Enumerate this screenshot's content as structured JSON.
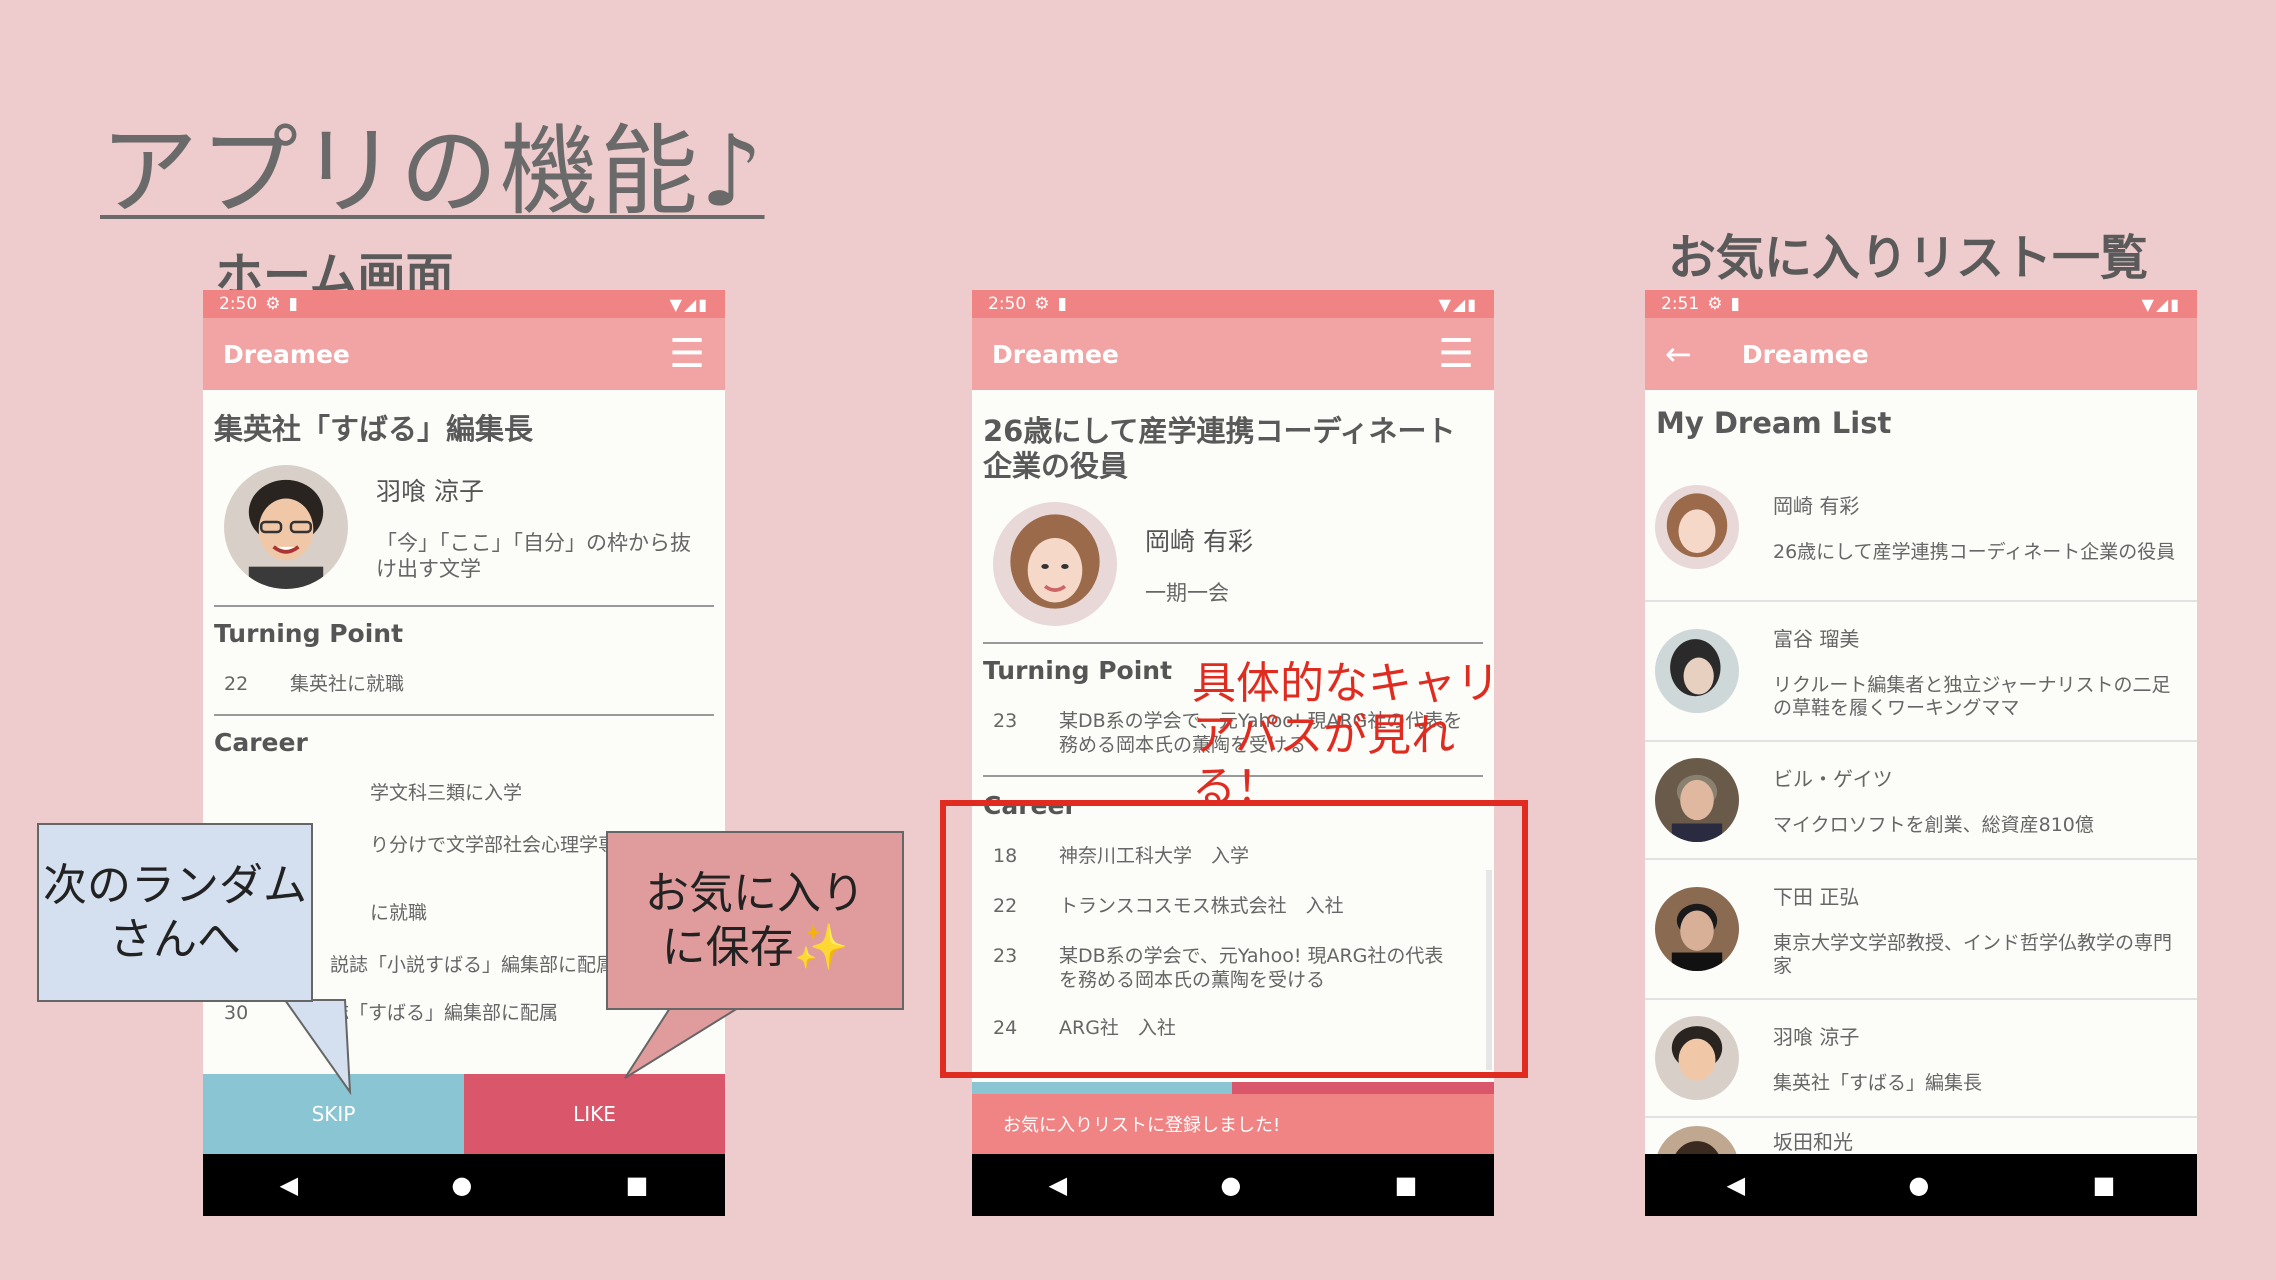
{
  "slide": {
    "title": "アプリの機能♪",
    "labels": {
      "home": "ホーム画面",
      "favorites": "お気に入りリスト一覧"
    }
  },
  "phone1": {
    "status_time": "2:50",
    "app_title": "Dreamee",
    "job_title": "集英社「すばる」編集長",
    "name": "羽喰 涼子",
    "motto": "「今」「ここ」「自分」の枠から抜け出す文学",
    "turning_point_label": "Turning Point",
    "turning_points": [
      {
        "age": "22",
        "text": "集英社に就職"
      }
    ],
    "career_label": "Career",
    "career": [
      {
        "age": "",
        "text": "学文科三類に入学"
      },
      {
        "age": "",
        "text": "り分けで文学部社会心理学専"
      },
      {
        "age": "",
        "text": "に就職"
      },
      {
        "age": "",
        "text": "説誌「小説すばる」編集部に配属"
      },
      {
        "age": "30",
        "text": "誌「すばる」編集部に配属"
      }
    ],
    "skip_label": "SKIP",
    "like_label": "LIKE"
  },
  "phone2": {
    "status_time": "2:50",
    "app_title": "Dreamee",
    "job_title": "26歳にして産学連携コーディネート企業の役員",
    "name": "岡崎 有彩",
    "motto": "一期一会",
    "turning_point_label": "Turning Point",
    "turning_points": [
      {
        "age": "23",
        "text": "某DB系の学会で、元Yahoo! 現ARG社の代表を務める岡本氏の薫陶を受ける"
      }
    ],
    "career_label": "Career",
    "career": [
      {
        "age": "18",
        "text": "神奈川工科大学　入学"
      },
      {
        "age": "22",
        "text": "トランスコスモス株式会社　入社"
      },
      {
        "age": "23",
        "text": "某DB系の学会で、元Yahoo! 現ARG社の代表を務める岡本氏の薫陶を受ける"
      },
      {
        "age": "24",
        "text": "ARG社　入社"
      }
    ],
    "snackbar": "お気に入りリストに登録しました!"
  },
  "phone3": {
    "status_time": "2:51",
    "app_title": "Dreamee",
    "list_title": "My Dream List",
    "items": [
      {
        "name": "岡崎 有彩",
        "desc": "26歳にして産学連携コーディネート企業の役員"
      },
      {
        "name": "富谷 瑠美",
        "desc": "リクルート編集者と独立ジャーナリストの二足の草鞋を履くワーキングママ"
      },
      {
        "name": "ビル・ゲイツ",
        "desc": "マイクロソフトを創業、総資産810億"
      },
      {
        "name": "下田 正弘",
        "desc": "東京大学文学部教授、インド哲学仏教学の専門家"
      },
      {
        "name": "羽喰 涼子",
        "desc": "集英社「すばる」編集長"
      },
      {
        "name": "坂田和光",
        "desc": ""
      }
    ]
  },
  "callouts": {
    "skip": "次のランダムさんへ",
    "like": "お気に入りに保存✨",
    "career": "具体的なキャリアパスが見れる！"
  },
  "colors": {
    "background": "#eecbcc",
    "statusbar": "#f08484",
    "appbar": "#f2a4a4",
    "skip_button": "#89c5d2",
    "like_button": "#d9566b",
    "highlight": "#e02b20"
  },
  "icons": {
    "menu": "list-menu-icon",
    "back": "back-arrow-icon",
    "settings": "gear-icon",
    "sd": "sd-card-icon",
    "wifi": "wifi-icon",
    "signal": "signal-icon",
    "battery": "battery-icon"
  }
}
